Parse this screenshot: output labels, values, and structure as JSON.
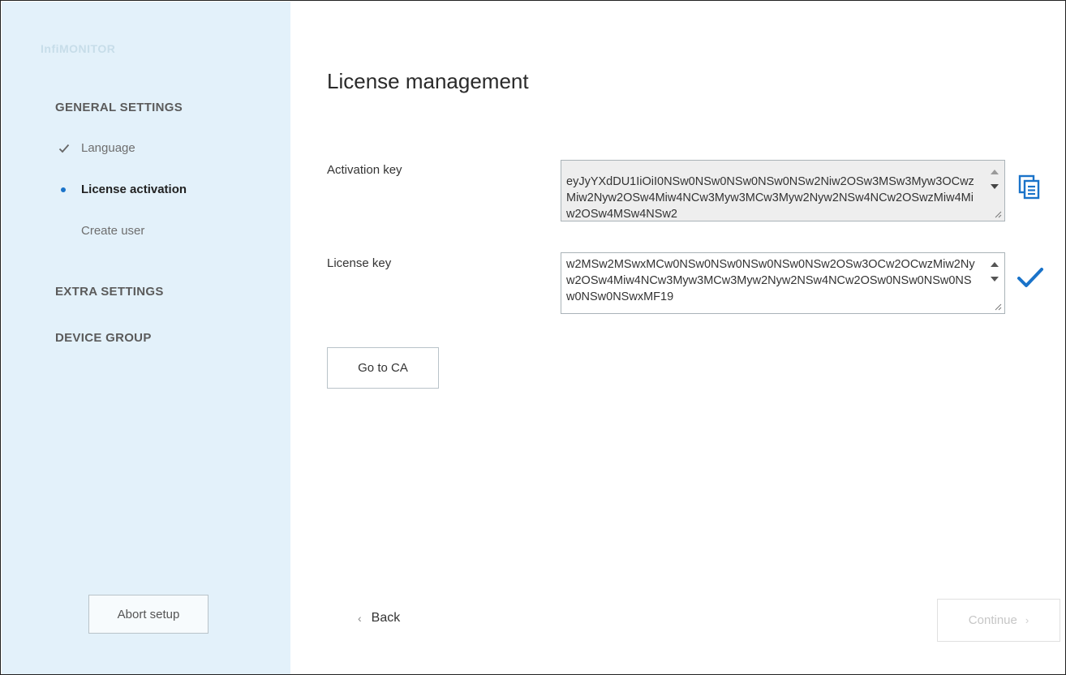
{
  "app": {
    "title": "InfiMONITOR"
  },
  "sidebar": {
    "general_heading": "GENERAL SETTINGS",
    "items": [
      {
        "label": "Language",
        "state": "done",
        "icon": "check-icon"
      },
      {
        "label": "License activation",
        "state": "current",
        "icon": "dot-icon"
      },
      {
        "label": "Create user",
        "state": "pending"
      }
    ],
    "extra_heading": "EXTRA SETTINGS",
    "device_heading": "DEVICE GROUP",
    "abort_label": "Abort setup"
  },
  "main": {
    "title": "License management",
    "activation": {
      "label": "Activation key",
      "value": "eyJyYXdDU1IiOiI0NSw0NSw0NSw0NSw0NSw2Niw2OSw3MSw3Myw3OCwzMiw2Nyw2OSw4Miw4NCw3Myw3MCw3Myw2Nyw2NSw4NCw2OSwzMiw4Miw2OSw4MSw4NSw2",
      "copy_icon": "copy-icon"
    },
    "license": {
      "label": "License key",
      "value": "w2MSw2MSwxMCw0NSw0NSw0NSw0NSw0NSw2OSw3OCw2OCwzMiw2Nyw2OSw4Miw4NCw3Myw3MCw3Myw2Nyw2NSw4NCw2OSw0NSw0NSw0NSw0NSw0NSwxMF19",
      "status_icon": "checkmark-icon"
    },
    "goca_label": "Go to CA",
    "back_label": "Back",
    "continue_label": "Continue"
  },
  "colors": {
    "sidebar_bg": "#e3f1fa",
    "accent": "#1a73c9",
    "disabled_text": "#c6c6c6"
  }
}
